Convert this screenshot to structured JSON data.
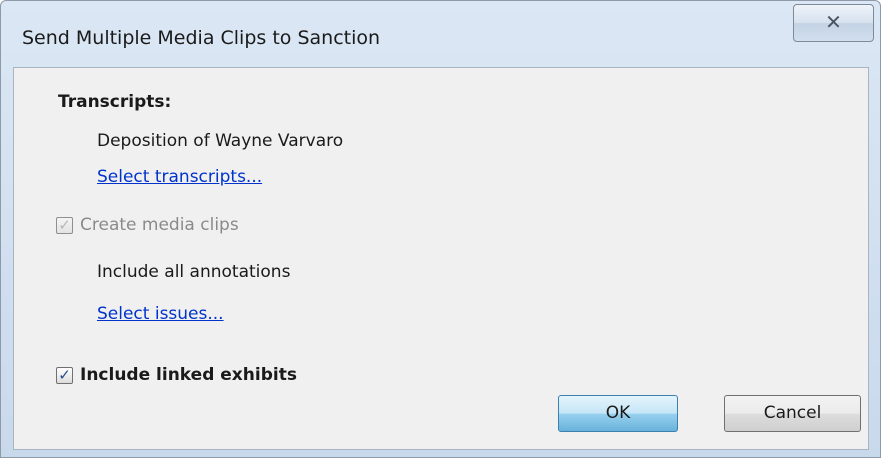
{
  "window": {
    "title": "Send Multiple Media Clips to Sanction",
    "close_icon": "close-x-icon"
  },
  "transcripts": {
    "label": "Transcripts:",
    "selected": "Deposition of Wayne Varvaro",
    "select_link": "Select transcripts..."
  },
  "media_clips": {
    "create_label": "Create media clips",
    "create_checked": true,
    "create_enabled": false,
    "annotations_text": "Include all annotations",
    "select_issues_link": "Select issues..."
  },
  "exhibits": {
    "label": "Include linked exhibits",
    "checked": true
  },
  "buttons": {
    "ok": "OK",
    "cancel": "Cancel"
  }
}
